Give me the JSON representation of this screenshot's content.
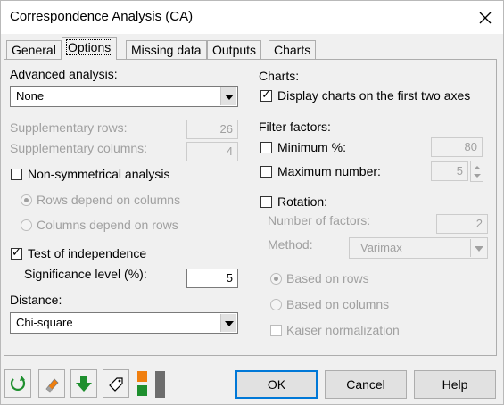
{
  "window": {
    "title": "Correspondence Analysis (CA)",
    "close_icon": "close-icon"
  },
  "tabs": [
    {
      "label": "General",
      "active": false
    },
    {
      "label": "Options",
      "active": true
    },
    {
      "label": "Missing data",
      "active": false
    },
    {
      "label": "Outputs",
      "active": false
    },
    {
      "label": "Charts",
      "active": false
    }
  ],
  "left": {
    "advanced_label": "Advanced analysis:",
    "advanced_value": "None",
    "supp_rows_label": "Supplementary rows:",
    "supp_rows_value": "26",
    "supp_cols_label": "Supplementary columns:",
    "supp_cols_value": "4",
    "nonsym_label": "Non-symmetrical analysis",
    "nonsym_checked": false,
    "rows_depend_label": "Rows depend on columns",
    "cols_depend_label": "Columns depend on rows",
    "test_indep_label": "Test of independence",
    "test_indep_checked": true,
    "signif_label": "Significance level (%):",
    "signif_value": "5",
    "distance_label": "Distance:",
    "distance_value": "Chi-square"
  },
  "right": {
    "charts_label": "Charts:",
    "display_charts_label": "Display charts on the first two axes",
    "display_charts_checked": true,
    "filter_label": "Filter factors:",
    "minimum_label": "Minimum %:",
    "minimum_value": "80",
    "maxnum_label": "Maximum number:",
    "maxnum_value": "5",
    "rotation_label": "Rotation:",
    "numfactors_label": "Number of factors:",
    "numfactors_value": "2",
    "method_label": "Method:",
    "method_value": "Varimax",
    "based_rows_label": "Based on rows",
    "based_cols_label": "Based on columns",
    "kaiser_label": "Kaiser normalization"
  },
  "toolbar": {
    "icons": [
      "reset-icon",
      "eraser-icon",
      "download-icon",
      "tag-icon",
      "layout-icon"
    ],
    "colors": {
      "green": "#1e8f2e",
      "orange": "#f07f0f",
      "grey": "#6d6d6d"
    }
  },
  "buttons": {
    "ok": "OK",
    "cancel": "Cancel",
    "help": "Help"
  }
}
